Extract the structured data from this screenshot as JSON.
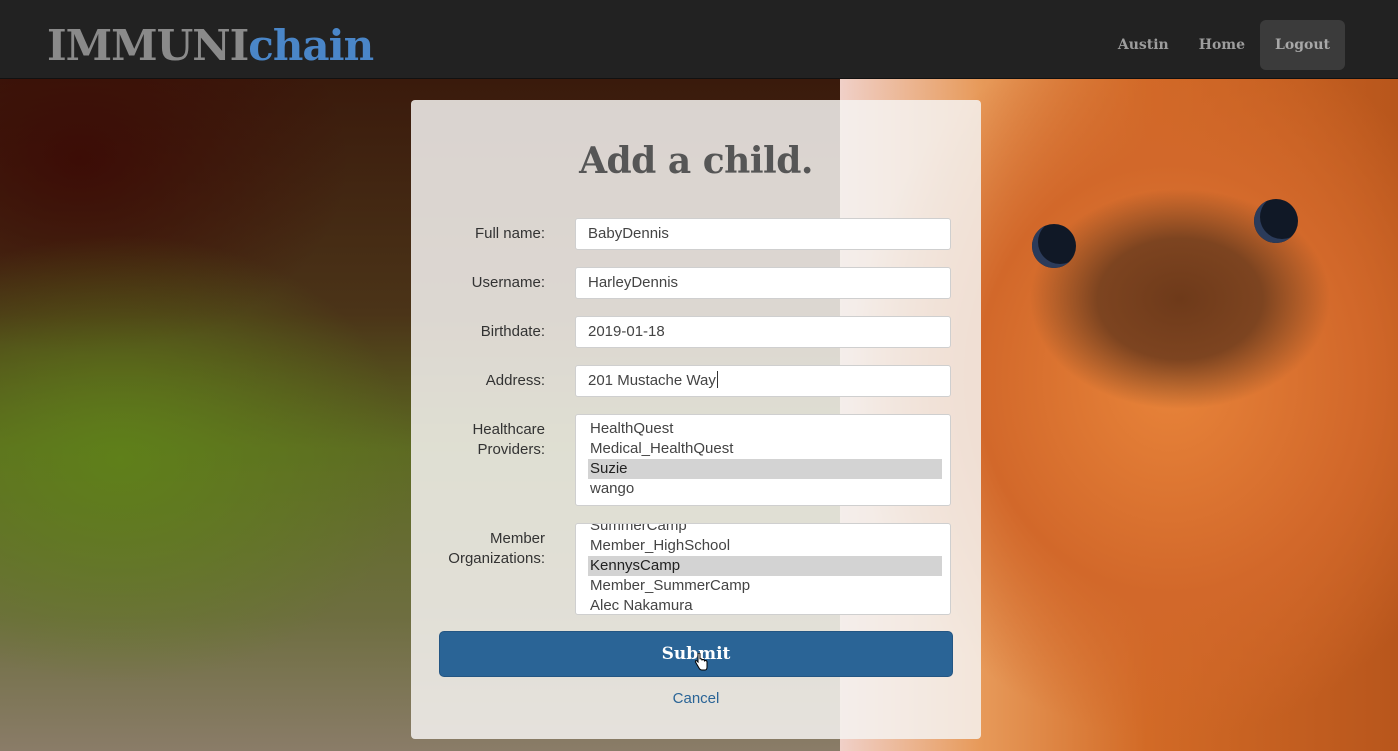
{
  "brand": {
    "part1": "IMMUNI",
    "part2": "chain"
  },
  "nav": {
    "user": "Austin",
    "home": "Home",
    "logout": "Logout"
  },
  "form": {
    "title": "Add a child.",
    "full_name": {
      "label": "Full name:",
      "value": "BabyDennis"
    },
    "username": {
      "label": "Username:",
      "value": "HarleyDennis"
    },
    "birthdate": {
      "label": "Birthdate:",
      "value": "2019-01-18"
    },
    "address": {
      "label": "Address:",
      "value": "201 Mustache Way"
    },
    "providers": {
      "label_line1": "Healthcare",
      "label_line2": "Providers:",
      "options": [
        "HealthQuest",
        "Medical_HealthQuest",
        "Suzie",
        "wango"
      ],
      "selected": "Suzie"
    },
    "organizations": {
      "label_line1": "Member",
      "label_line2": "Organizations:",
      "options": [
        "SummerCamp",
        "Member_HighSchool",
        "KennysCamp",
        "Member_SummerCamp",
        "Alec Nakamura"
      ],
      "selected": "KennysCamp"
    },
    "submit_label": "Submit",
    "cancel_label": "Cancel"
  },
  "colors": {
    "accent": "#4a86c8",
    "button": "#2a6496",
    "navbar": "#222222"
  }
}
